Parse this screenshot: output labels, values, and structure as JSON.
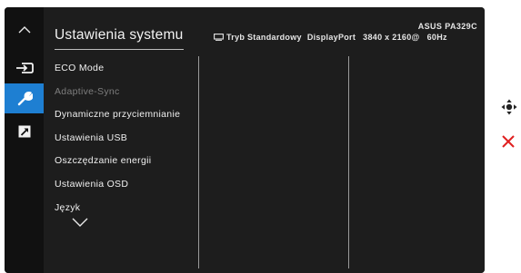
{
  "osd": {
    "title": "Ustawienia systemu",
    "model": "ASUS PA329C",
    "status": {
      "mode": "Tryb Standardowy",
      "input": "DisplayPort",
      "resolution": "3840 x 2160@",
      "refresh": "60Hz"
    },
    "menu": [
      {
        "label": "ECO Mode",
        "enabled": true
      },
      {
        "label": "Adaptive-Sync",
        "enabled": false
      },
      {
        "label": "Dynamiczne przyciemnianie",
        "enabled": true
      },
      {
        "label": "Ustawienia USB",
        "enabled": true
      },
      {
        "label": "Oszczędzanie energii",
        "enabled": true
      },
      {
        "label": "Ustawienia OSD",
        "enabled": true
      },
      {
        "label": "Język",
        "enabled": true
      }
    ]
  },
  "nav": [
    {
      "icon": "chevron-up-icon",
      "active": false
    },
    {
      "icon": "input-select-icon",
      "active": false
    },
    {
      "icon": "wrench-icon",
      "active": true
    },
    {
      "icon": "shortcut-arrow-icon",
      "active": false
    }
  ],
  "colors": {
    "active_accent": "#1e7fd2",
    "osd_background": "#1d1d1d",
    "close_red": "#e02020"
  },
  "side_keys": [
    "move-joystick-icon",
    "close-x-icon"
  ]
}
